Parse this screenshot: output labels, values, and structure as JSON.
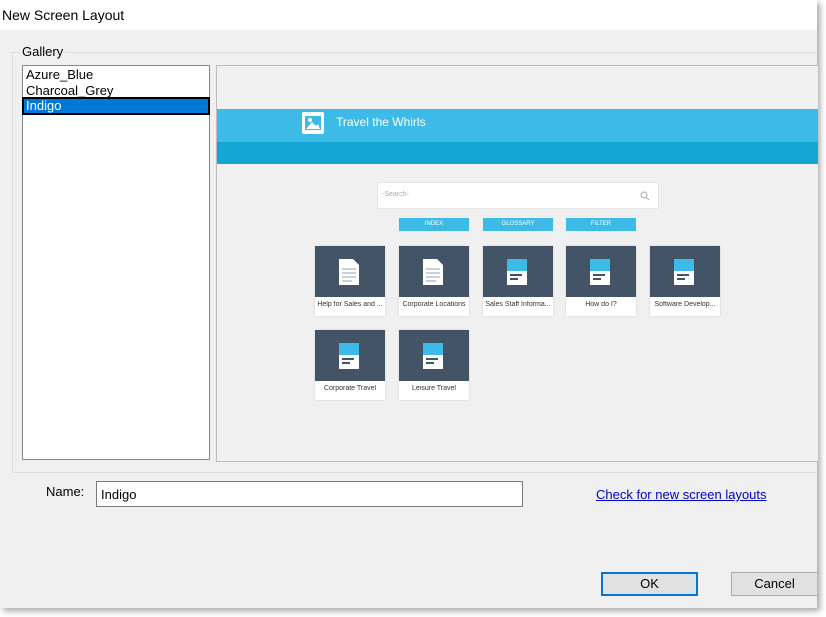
{
  "window": {
    "title": "New Screen Layout"
  },
  "gallery": {
    "label": "Gallery",
    "items": [
      {
        "label": "Azure_Blue"
      },
      {
        "label": "Charcoal_Grey"
      },
      {
        "label": "Indigo",
        "selected": true
      }
    ]
  },
  "preview": {
    "header_title": "Travel the Whirls",
    "search_placeholder": "-Search-",
    "buttons": [
      "INDEX",
      "GLOSSARY",
      "FILTER"
    ],
    "tiles": [
      {
        "label": "Help for Sales and ...",
        "icon": "document-icon"
      },
      {
        "label": "Corporate Locations",
        "icon": "document-icon"
      },
      {
        "label": "Sales Staff Informa...",
        "icon": "book-icon"
      },
      {
        "label": "How do I?",
        "icon": "book-icon"
      },
      {
        "label": "Software Develop...",
        "icon": "book-icon"
      },
      {
        "label": "Corporate Travel",
        "icon": "book-icon"
      },
      {
        "label": "Leisure Travel",
        "icon": "book-icon"
      }
    ],
    "colors": {
      "header": "#3dbbe6",
      "header_dark": "#14a6d4",
      "tile": "#445467"
    }
  },
  "name_field": {
    "label": "Name:",
    "value": "Indigo"
  },
  "check_link": "Check for new screen layouts",
  "buttons": {
    "ok": "OK",
    "cancel": "Cancel"
  }
}
